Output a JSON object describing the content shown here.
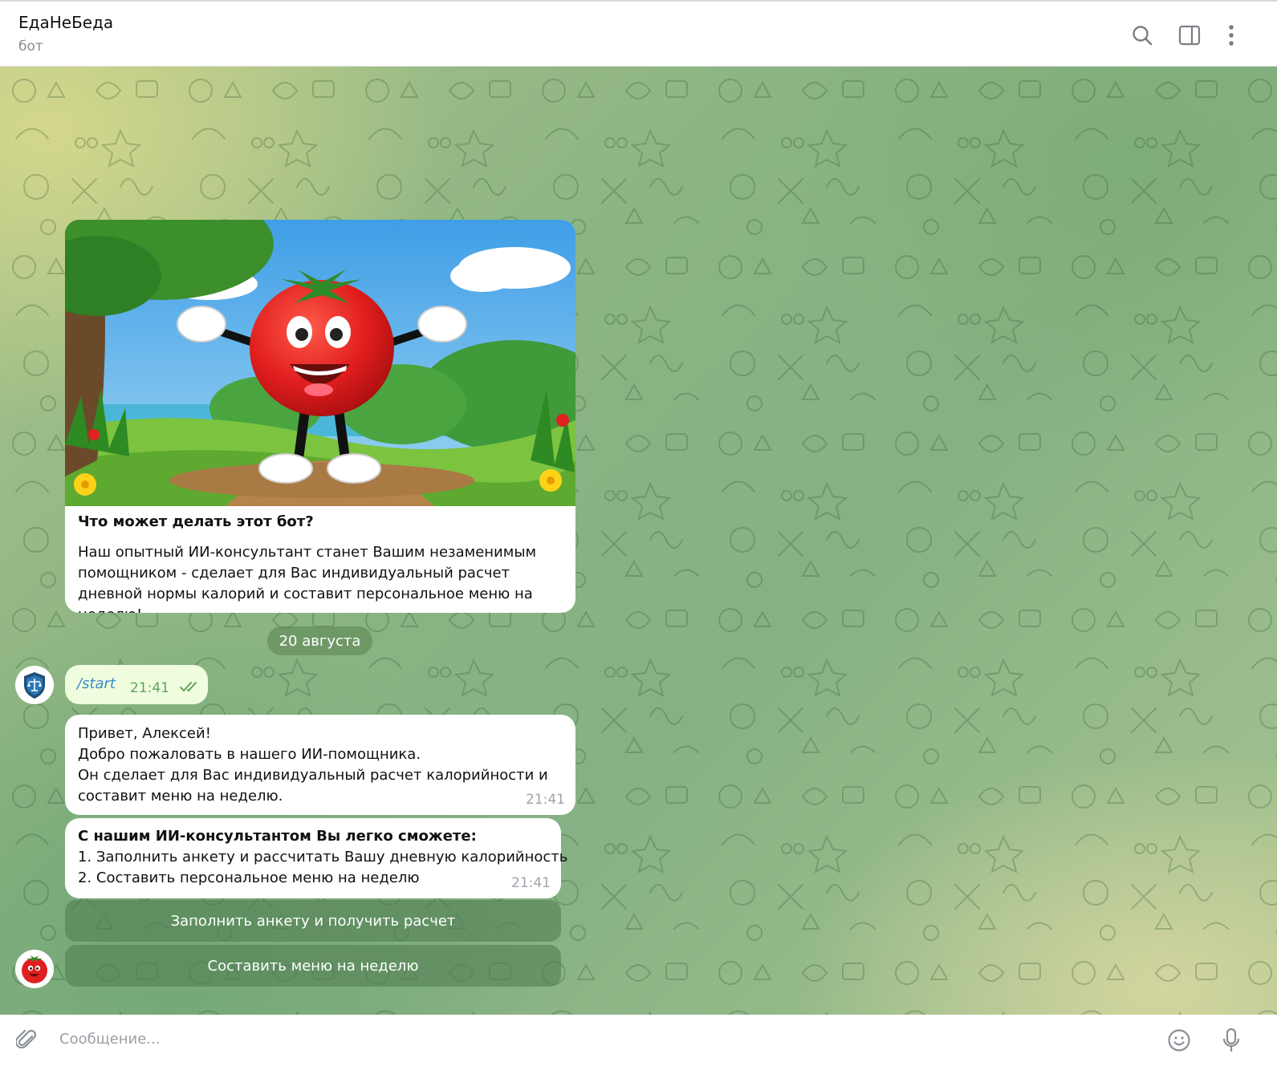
{
  "header": {
    "title": "ЕдаНеБеда",
    "subtitle": "бот",
    "icons": [
      "search-icon",
      "sidebar-toggle-icon",
      "more-vertical-icon"
    ]
  },
  "intro_card": {
    "title": "Что может делать этот бот?",
    "text": "Наш опытный ИИ-консультант станет Вашим незаменимым помощником - сделает для Вас индивидуальный расчет дневной нормы калорий и составит персональное меню на неделю!"
  },
  "date_separator": "20 августа",
  "messages": {
    "outgoing": {
      "text": "/start",
      "time": "21:41",
      "status": "read"
    },
    "greeting": {
      "lines": [
        "Привет, Алексей!",
        "Добро пожаловать в нашего ИИ-помощника.",
        "Он сделает для Вас индивидуальный расчет калорийности и",
        "составит меню на неделю."
      ],
      "time": "21:41"
    },
    "features": {
      "heading": "С нашим ИИ-консультантом Вы легко сможете:",
      "items": [
        "1. Заполнить анкету и рассчитать Вашу дневную калорийность",
        "2. Составить персональное меню на неделю"
      ],
      "time": "21:41"
    }
  },
  "keyboard": {
    "buttons": [
      "Заполнить анкету и получить расчет",
      "Составить меню на неделю"
    ]
  },
  "composer": {
    "placeholder": "Сообщение...",
    "icons": [
      "attach-icon",
      "emoji-icon",
      "microphone-icon"
    ]
  },
  "colors": {
    "outgoing_bubble": "#effdde",
    "incoming_bubble": "#ffffff",
    "link": "#3a8bc8",
    "read_ticks": "#5fa25b",
    "keyboard_button": "#528052"
  }
}
